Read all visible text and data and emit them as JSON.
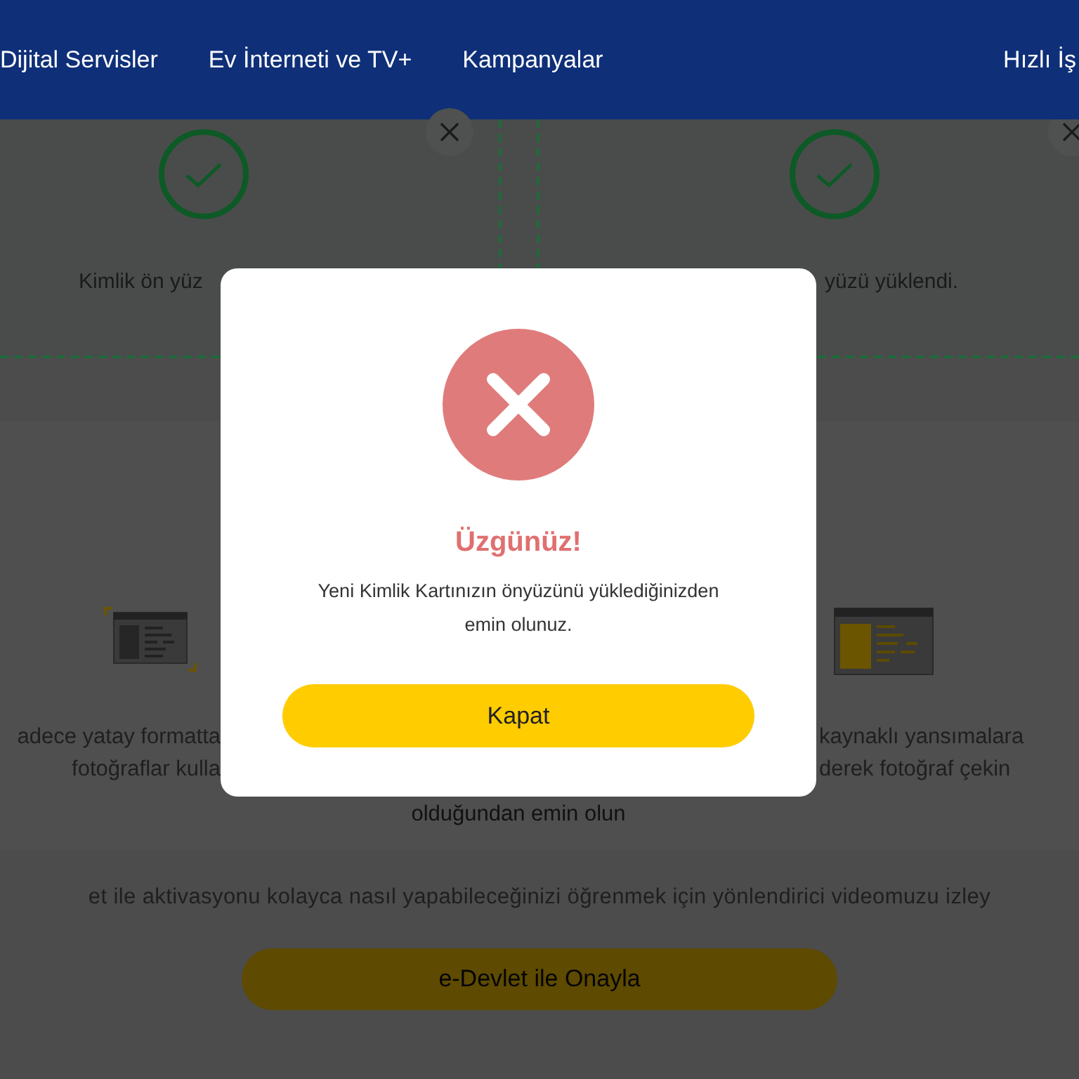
{
  "nav": {
    "items": [
      "Dijital Servisler",
      "Ev İnterneti ve TV+",
      "Kampanyalar"
    ],
    "right_item": "Hızlı İş"
  },
  "upload_cards": [
    {
      "text": "Kimlik ön yüz",
      "uploaded": true
    },
    {
      "text": "yüzü yüklendi.",
      "uploaded": true
    }
  ],
  "tips": {
    "left": [
      "adece yatay formatta",
      "fotoğraflar kulla"
    ],
    "middle": "olduğundan emin olun",
    "right": [
      "kaynaklı yansımalara",
      "derek fotoğraf çekin"
    ]
  },
  "info_text": "et ile aktivasyonu kolayca nasıl yapabileceğinizi öğrenmek için yönlendirici videomuzu izley",
  "confirm_button": "e-Devlet ile Onayla",
  "dialog": {
    "kind": "error",
    "title": "Üzgünüz!",
    "message": "Yeni Kimlik Kartınızın önyüzünü yüklediğinizden emin olunuz.",
    "button": "Kapat"
  }
}
